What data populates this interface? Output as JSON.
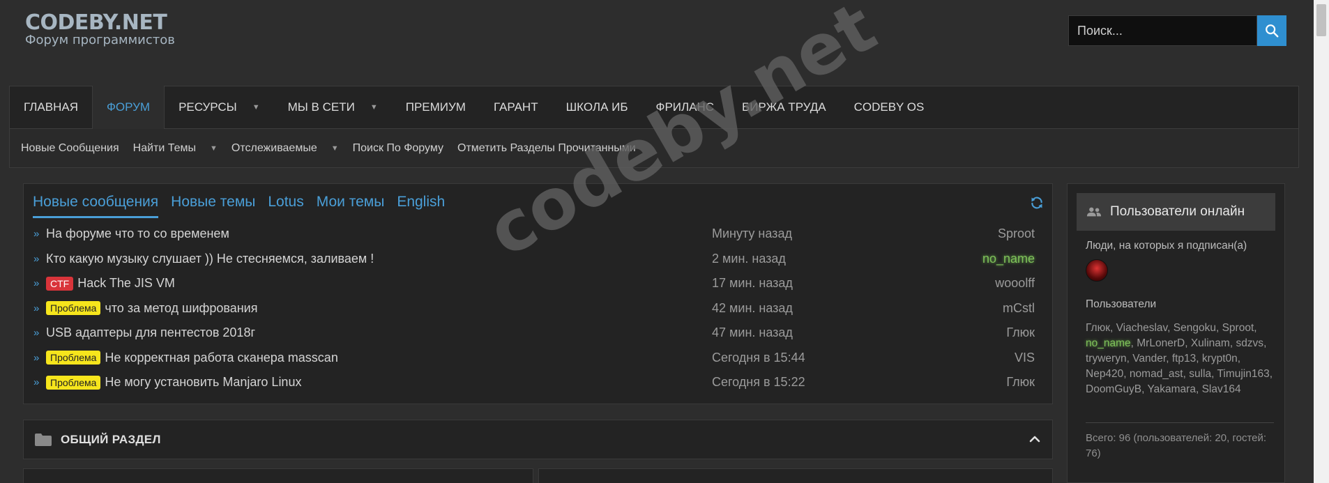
{
  "logo": {
    "main": "CODEBY.NET",
    "sub": "Форум программистов"
  },
  "search": {
    "placeholder": "Поиск..."
  },
  "nav": {
    "items": [
      {
        "label": "ГЛАВНАЯ"
      },
      {
        "label": "ФОРУМ"
      },
      {
        "label": "РЕСУРСЫ"
      },
      {
        "label": "МЫ В СЕТИ"
      },
      {
        "label": "ПРЕМИУМ"
      },
      {
        "label": "ГАРАНТ"
      },
      {
        "label": "ШКОЛА ИБ"
      },
      {
        "label": "ФРИЛАНС"
      },
      {
        "label": "БИРЖА ТРУДА"
      },
      {
        "label": "CODEBY OS"
      }
    ]
  },
  "subnav": {
    "items": [
      {
        "label": "Новые Сообщения"
      },
      {
        "label": "Найти Темы"
      },
      {
        "label": "Отслеживаемые"
      },
      {
        "label": "Поиск По Форуму"
      },
      {
        "label": "Отметить Разделы Прочитанными"
      }
    ]
  },
  "latest": {
    "tabs": [
      {
        "label": "Новые сообщения"
      },
      {
        "label": "Новые темы"
      },
      {
        "label": "Lotus"
      },
      {
        "label": "Мои темы"
      },
      {
        "label": "English"
      }
    ],
    "rows": [
      {
        "prefix": "",
        "title": "На форуме что то со временем",
        "time": "Минуту назад",
        "user": "Sproot"
      },
      {
        "prefix": "",
        "title": "Кто какую музыку слушает )) Не стесняемся, заливаем !",
        "time": "2 мин. назад",
        "user": "no_name"
      },
      {
        "prefix": "CTF",
        "title": "Hack The JIS VM",
        "time": "17 мин. назад",
        "user": "wooolff"
      },
      {
        "prefix": "Проблема",
        "title": "что за метод шифрования",
        "time": "42 мин. назад",
        "user": "mCstl"
      },
      {
        "prefix": "",
        "title": "USB адаптеры для пентестов 2018г",
        "time": "47 мин. назад",
        "user": "Глюк"
      },
      {
        "prefix": "Проблема",
        "title": "Не корректная работа сканера masscan",
        "time": "Сегодня в 15:44",
        "user": "VIS"
      },
      {
        "prefix": "Проблема",
        "title": "Не могу установить Manjaro Linux",
        "time": "Сегодня в 15:22",
        "user": "Глюк"
      }
    ]
  },
  "section": {
    "title": "ОБЩИЙ РАЗДЕЛ"
  },
  "sidebar": {
    "title": "Пользователи онлайн",
    "following_label": "Люди, на которых я подписан(а)",
    "users_label": "Пользователи",
    "users": [
      "Глюк",
      "Viacheslav",
      "Sengoku",
      "Sproot",
      "no_name",
      "MrLonerD",
      "Xulinam",
      "sdzvs",
      "tryweryn",
      "Vander",
      "ftp13",
      "krypt0n",
      "Nep420",
      "nomad_ast",
      "sulla",
      "Timujin163",
      "DoomGuyB",
      "Yakamara",
      "Slav164"
    ],
    "total": "Всего: 96 (пользователей: 20, гостей: 76)"
  },
  "watermark": "codeby.net",
  "colors": {
    "accent": "#4a9fd8",
    "ctf_prefix": "#d9343a",
    "problem_prefix": "#f6e51c",
    "online_highlight": "#7fc25a"
  }
}
